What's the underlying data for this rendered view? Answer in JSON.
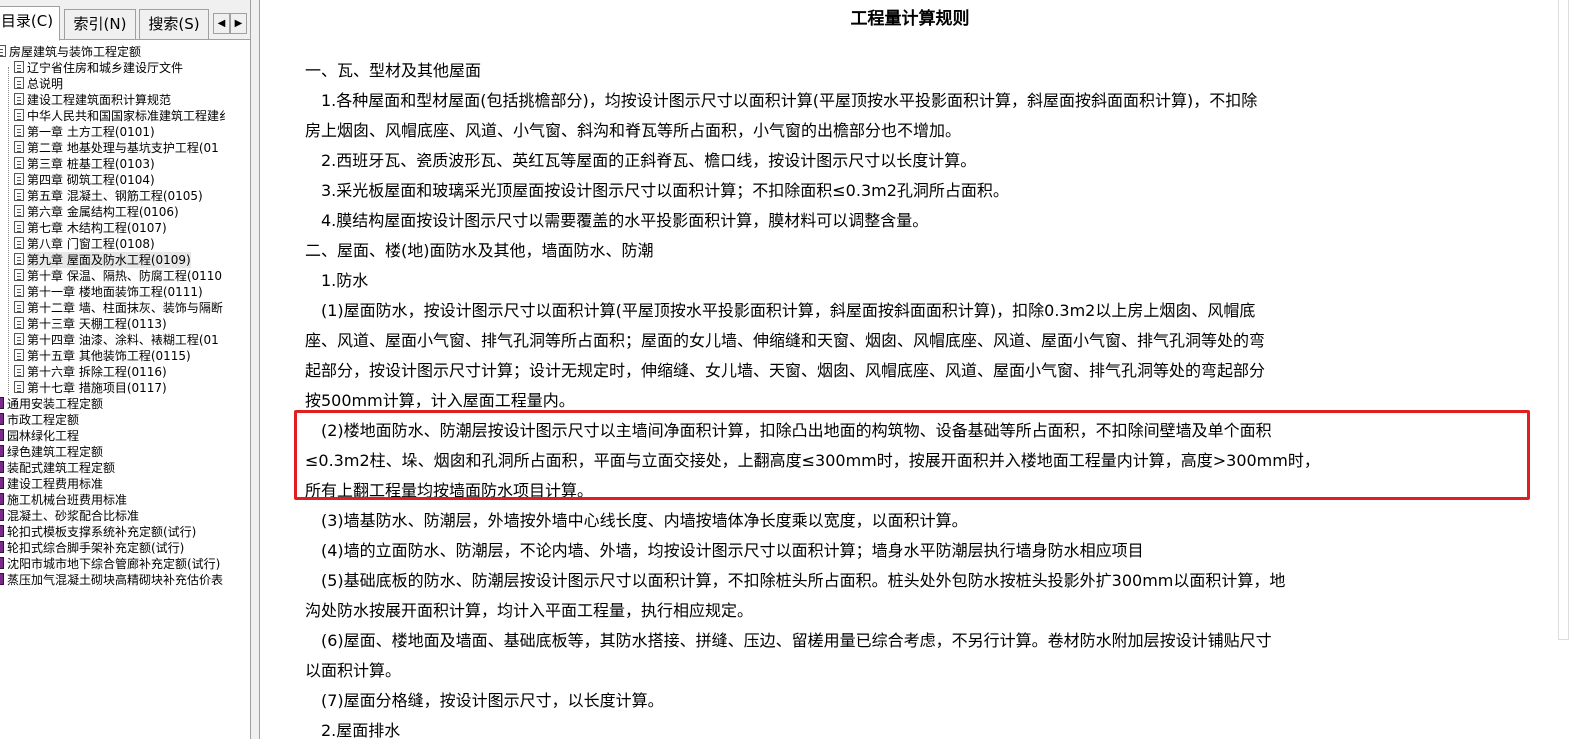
{
  "tabs": {
    "toc": "目录(C)",
    "index": "索引(N)",
    "search": "搜索(S)",
    "prev": "◀",
    "next": "▶"
  },
  "tree": [
    {
      "label": "房屋建筑与装饰工程定额",
      "level": 0,
      "icon": "doc-icon"
    },
    {
      "label": "辽宁省住房和城乡建设厅文件",
      "level": 1,
      "icon": "doc-icon"
    },
    {
      "label": "总说明",
      "level": 1,
      "icon": "doc-icon"
    },
    {
      "label": "建设工程建筑面积计算规范",
      "level": 1,
      "icon": "doc-icon"
    },
    {
      "label": "中华人民共和国国家标准建筑工程建纟",
      "level": 1,
      "icon": "doc-icon"
    },
    {
      "label": "第一章  土方工程(0101)",
      "level": 1,
      "icon": "doc-icon"
    },
    {
      "label": "第二章  地基处理与基坑支护工程(01",
      "level": 1,
      "icon": "doc-icon"
    },
    {
      "label": "第三章  桩基工程(0103)",
      "level": 1,
      "icon": "doc-icon"
    },
    {
      "label": "第四章  砌筑工程(0104)",
      "level": 1,
      "icon": "doc-icon"
    },
    {
      "label": "第五章  混凝土、钢筋工程(0105)",
      "level": 1,
      "icon": "doc-icon"
    },
    {
      "label": "第六章  金属结构工程(0106)",
      "level": 1,
      "icon": "doc-icon"
    },
    {
      "label": "第七章  木结构工程(0107)",
      "level": 1,
      "icon": "doc-icon"
    },
    {
      "label": "第八章  门窗工程(0108)",
      "level": 1,
      "icon": "doc-icon"
    },
    {
      "label": "第九章  屋面及防水工程(0109)",
      "level": 1,
      "icon": "doc-icon",
      "selected": true
    },
    {
      "label": "第十章  保温、隔热、防腐工程(0110",
      "level": 1,
      "icon": "doc-icon"
    },
    {
      "label": "第十一章  楼地面装饰工程(0111)",
      "level": 1,
      "icon": "doc-icon"
    },
    {
      "label": "第十二章  墙、柱面抹灰、装饰与隔断",
      "level": 1,
      "icon": "doc-icon"
    },
    {
      "label": "第十三章  天棚工程(0113)",
      "level": 1,
      "icon": "doc-icon"
    },
    {
      "label": "第十四章  油漆、涂料、裱糊工程(01",
      "level": 1,
      "icon": "doc-icon"
    },
    {
      "label": "第十五章  其他装饰工程(0115)",
      "level": 1,
      "icon": "doc-icon"
    },
    {
      "label": "第十六章  拆除工程(0116)",
      "level": 1,
      "icon": "doc-icon"
    },
    {
      "label": "第十七章  措施项目(0117)",
      "level": 1,
      "icon": "doc-icon"
    },
    {
      "label": "通用安装工程定额",
      "level": 0,
      "icon": "book-icon"
    },
    {
      "label": "市政工程定额",
      "level": 0,
      "icon": "book-icon"
    },
    {
      "label": "园林绿化工程",
      "level": 0,
      "icon": "book-icon"
    },
    {
      "label": "绿色建筑工程定额",
      "level": 0,
      "icon": "book-icon"
    },
    {
      "label": "装配式建筑工程定额",
      "level": 0,
      "icon": "book-icon"
    },
    {
      "label": "建设工程费用标准",
      "level": 0,
      "icon": "book-icon"
    },
    {
      "label": "施工机械台班费用标准",
      "level": 0,
      "icon": "book-icon"
    },
    {
      "label": "混凝土、砂浆配合比标准",
      "level": 0,
      "icon": "book-icon"
    },
    {
      "label": "轮扣式模板支撑系统补充定额(试行)",
      "level": 0,
      "icon": "book-icon"
    },
    {
      "label": "轮扣式综合脚手架补充定额(试行)",
      "level": 0,
      "icon": "book-icon"
    },
    {
      "label": "沈阳市城市地下综合管廊补充定额(试行)",
      "level": 0,
      "icon": "book-icon"
    },
    {
      "label": "蒸压加气混凝土砌块高精砌块补充估价表",
      "level": 0,
      "icon": "book-icon"
    }
  ],
  "content": {
    "title": "工程量计算规则",
    "lines": [
      "一、瓦、型材及其他屋面",
      "　1.各种屋面和型材屋面(包括挑檐部分)，均按设计图示尺寸以面积计算(平屋顶按水平投影面积计算，斜屋面按斜面面积计算)，不扣除",
      "房上烟囱、风帽底座、风道、小气窗、斜沟和脊瓦等所占面积，小气窗的出檐部分也不增加。",
      "　2.西班牙瓦、瓷质波形瓦、英红瓦等屋面的正斜脊瓦、檐口线，按设计图示尺寸以长度计算。",
      "　3.采光板屋面和玻璃采光顶屋面按设计图示尺寸以面积计算；不扣除面积≤0.3m2孔洞所占面积。",
      "　4.膜结构屋面按设计图示尺寸以需要覆盖的水平投影面积计算，膜材料可以调整含量。",
      "二、屋面、楼(地)面防水及其他，墙面防水、防潮",
      "　1.防水",
      "　(1)屋面防水，按设计图示尺寸以面积计算(平屋顶按水平投影面积计算，斜屋面按斜面面积计算)，扣除0.3m2以上房上烟囱、风帽底",
      "座、风道、屋面小气窗、排气孔洞等所占面积；屋面的女儿墙、伸缩缝和天窗、烟囱、风帽底座、风道、屋面小气窗、排气孔洞等处的弯",
      "起部分，按设计图示尺寸计算；设计无规定时，伸缩缝、女儿墙、天窗、烟囱、风帽底座、风道、屋面小气窗、排气孔洞等处的弯起部分",
      "按500mm计算，计入屋面工程量内。",
      "　(2)楼地面防水、防潮层按设计图示尺寸以主墙间净面积计算，扣除凸出地面的构筑物、设备基础等所占面积，不扣除间壁墙及单个面积",
      "≤0.3m2柱、垛、烟囱和孔洞所占面积，平面与立面交接处，上翻高度≤300mm时，按展开面积并入楼地面工程量内计算，高度>300mm时，",
      "所有上翻工程量均按墙面防水项目计算。",
      "　(3)墙基防水、防潮层，外墙按外墙中心线长度、内墙按墙体净长度乘以宽度，以面积计算。",
      "　(4)墙的立面防水、防潮层，不论内墙、外墙，均按设计图示尺寸以面积计算；墙身水平防潮层执行墙身防水相应项目",
      "　(5)基础底板的防水、防潮层按设计图示尺寸以面积计算，不扣除桩头所占面积。桩头处外包防水按桩头投影外扩300mm以面积计算，地",
      "沟处防水按展开面积计算，均计入平面工程量，执行相应规定。",
      "　(6)屋面、楼地面及墙面、基础底板等，其防水搭接、拼缝、压边、留槎用量已综合考虑，不另行计算。卷材防水附加层按设计铺贴尺寸",
      "以面积计算。",
      "　(7)屋面分格缝，按设计图示尺寸，以长度计算。",
      "　2.屋面排水"
    ]
  },
  "colors": {
    "highlight": "#e02020"
  }
}
